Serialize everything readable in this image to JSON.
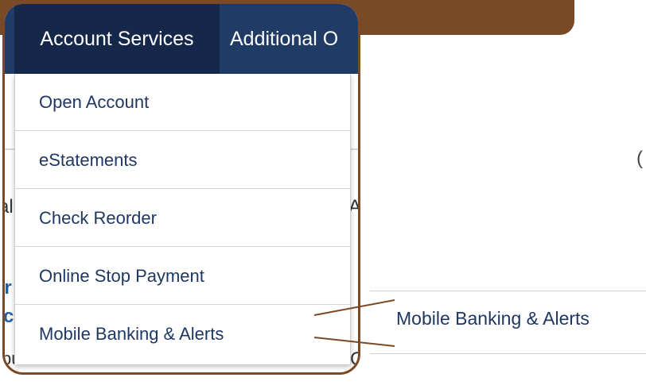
{
  "nav": {
    "account_services": "Account Services",
    "additional": "Additional O"
  },
  "dropdown": {
    "items": [
      "Open Account",
      "eStatements",
      "Check Reorder",
      "Online Stop Payment",
      "Mobile Banking & Alerts"
    ]
  },
  "background_fragments": {
    "frag_a1": "al",
    "frag_a2": "A",
    "frag_b": "ar",
    "frag_c": "c",
    "frag_d": "button located at the bottom. You",
    "frag_e": "C",
    "edge": "("
  },
  "callout": {
    "label": "Mobile Banking & Alerts"
  },
  "colors": {
    "nav_bg": "#1f3b66",
    "nav_active": "#16284a",
    "link_text": "#1e3763",
    "frame": "#7a4a26"
  }
}
